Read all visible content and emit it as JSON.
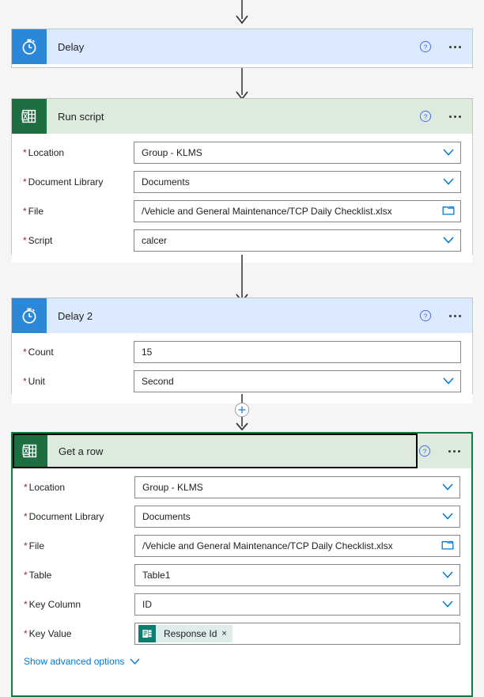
{
  "canvas": {
    "background_color": "#f5f5f5",
    "connector_color": "#3b3a39"
  },
  "colors": {
    "delay_icon_bg": "#2b88d8",
    "delay_header_bg": "#dbeafe",
    "excel_icon_bg": "#1d6f42",
    "excel_header_bg": "#dcebdd",
    "selected_border": "#107c41",
    "focus_outline": "#000000",
    "required_asterisk": "#a4262c",
    "link": "#0078d4",
    "forms_token_bg": "#deeceb",
    "forms_icon_bg": "#0f7c70"
  },
  "common": {
    "help_icon": "help-circle-icon",
    "more_icon": "ellipsis-icon",
    "chevron_icon": "chevron-down-icon",
    "folder_icon": "folder-picker-icon",
    "add_step_icon": "plus-circle-icon",
    "arrow_icon": "arrow-down-icon",
    "required_marker": "*"
  },
  "steps": [
    {
      "id": "delay",
      "title": "Delay",
      "icon": "stopwatch-icon",
      "theme": "blue",
      "selected": false,
      "fields": []
    },
    {
      "id": "run-script",
      "title": "Run script",
      "icon": "excel-icon",
      "theme": "green",
      "selected": false,
      "fields": [
        {
          "label": "Location",
          "required": true,
          "value": "Group - KLMS",
          "control": "dropdown"
        },
        {
          "label": "Document Library",
          "required": true,
          "value": "Documents",
          "control": "dropdown"
        },
        {
          "label": "File",
          "required": true,
          "value": "/Vehicle and General Maintenance/TCP Daily Checklist.xlsx",
          "control": "filepicker"
        },
        {
          "label": "Script",
          "required": true,
          "value": "calcer",
          "control": "dropdown"
        }
      ]
    },
    {
      "id": "delay-2",
      "title": "Delay 2",
      "icon": "stopwatch-icon",
      "theme": "blue",
      "selected": false,
      "fields": [
        {
          "label": "Count",
          "required": true,
          "value": "15",
          "control": "text"
        },
        {
          "label": "Unit",
          "required": true,
          "value": "Second",
          "control": "dropdown"
        }
      ]
    },
    {
      "id": "get-a-row",
      "title": "Get a row",
      "icon": "excel-icon",
      "theme": "green",
      "selected": true,
      "fields": [
        {
          "label": "Location",
          "required": true,
          "value": "Group - KLMS",
          "control": "dropdown"
        },
        {
          "label": "Document Library",
          "required": true,
          "value": "Documents",
          "control": "dropdown"
        },
        {
          "label": "File",
          "required": true,
          "value": "/Vehicle and General Maintenance/TCP Daily Checklist.xlsx",
          "control": "filepicker"
        },
        {
          "label": "Table",
          "required": true,
          "value": "Table1",
          "control": "dropdown"
        },
        {
          "label": "Key Column",
          "required": true,
          "value": "ID",
          "control": "dropdown"
        },
        {
          "label": "Key Value",
          "required": true,
          "value": "Response Id",
          "control": "token",
          "token_icon": "microsoft-forms-icon",
          "token_remove": "×"
        }
      ],
      "advanced_options_label": "Show advanced options"
    }
  ],
  "labels": {
    "delay_title": "Delay",
    "run_script_title": "Run script",
    "delay2_title": "Delay 2",
    "get_a_row_title": "Get a row",
    "rs_location_label": "Location",
    "rs_location_value": "Group - KLMS",
    "rs_doclib_label": "Document Library",
    "rs_doclib_value": "Documents",
    "rs_file_label": "File",
    "rs_file_value": "/Vehicle and General Maintenance/TCP Daily Checklist.xlsx",
    "rs_script_label": "Script",
    "rs_script_value": "calcer",
    "d2_count_label": "Count",
    "d2_count_value": "15",
    "d2_unit_label": "Unit",
    "d2_unit_value": "Second",
    "gr_location_label": "Location",
    "gr_location_value": "Group - KLMS",
    "gr_doclib_label": "Document Library",
    "gr_doclib_value": "Documents",
    "gr_file_label": "File",
    "gr_file_value": "/Vehicle and General Maintenance/TCP Daily Checklist.xlsx",
    "gr_table_label": "Table",
    "gr_table_value": "Table1",
    "gr_keycol_label": "Key Column",
    "gr_keycol_value": "ID",
    "gr_keyval_label": "Key Value",
    "gr_keyval_token": "Response Id",
    "gr_token_remove": "×",
    "gr_advanced": "Show advanced options",
    "asterisk": "*"
  }
}
